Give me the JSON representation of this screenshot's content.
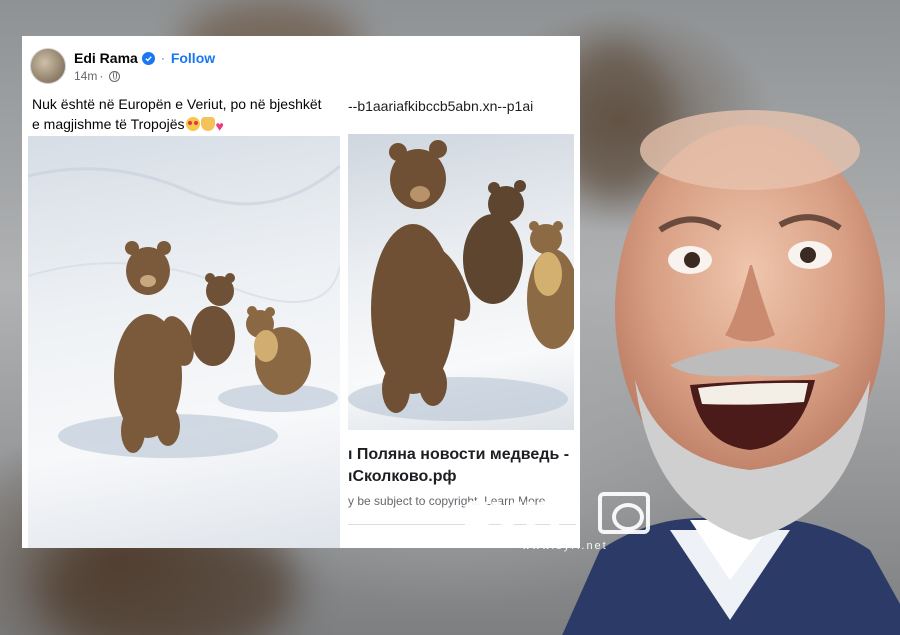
{
  "post": {
    "author": "Edi Rama",
    "follow_label": "Follow",
    "separator": "·",
    "timestamp": "14m",
    "caption": "Nuk është në Europën e Veriut, po në bjeshkët e magjishme të Tropojës",
    "caption_emojis": [
      "smiling-face-with-heart-eyes",
      "heart-hands",
      "pink-heart"
    ]
  },
  "link_preview": {
    "url_text": "--b1aariafkibccb5abn.xn--p1ai",
    "title_line1": "ı Поляна новости медведь -",
    "title_line2": "ıСколково.рф",
    "note": "y be subject to copyright. Learn More"
  },
  "watermark": {
    "logo_text": "syri",
    "url": "www.syri.net"
  },
  "colors": {
    "facebook_blue": "#1877f2",
    "card_bg": "#ffffff",
    "text_primary": "#050505",
    "text_secondary": "#65676b"
  }
}
